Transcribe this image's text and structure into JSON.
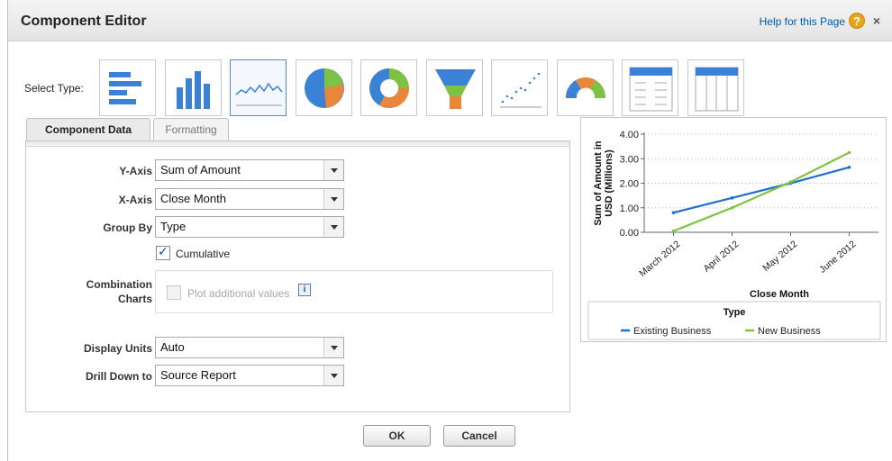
{
  "header": {
    "title": "Component Editor",
    "help_link": "Help for this Page",
    "help_icon": "?",
    "close_icon": "×"
  },
  "select_type": {
    "label": "Select Type:",
    "selected": "line",
    "options": [
      "horizontal-bar",
      "vertical-bar",
      "line",
      "pie",
      "donut",
      "funnel",
      "scatter",
      "gauge",
      "table",
      "table-grid"
    ]
  },
  "tabs": [
    {
      "label": "Component Data",
      "active": true
    },
    {
      "label": "Formatting",
      "active": false
    }
  ],
  "form": {
    "y_axis": {
      "label": "Y-Axis",
      "value": "Sum of Amount"
    },
    "x_axis": {
      "label": "X-Axis",
      "value": "Close Month"
    },
    "group_by": {
      "label": "Group By",
      "value": "Type"
    },
    "cumulative": {
      "label": "Cumulative",
      "checked": true
    },
    "combination_charts": {
      "label_line1": "Combination",
      "label_line2": "Charts"
    },
    "plot_additional": {
      "label": "Plot additional values",
      "checked": false,
      "disabled": true,
      "info_icon": "i"
    },
    "display_units": {
      "label": "Display Units",
      "value": "Auto"
    },
    "drill_down": {
      "label": "Drill Down to",
      "value": "Source Report"
    }
  },
  "chart_data": {
    "type": "line",
    "categories": [
      "March 2012",
      "April 2012",
      "May 2012",
      "June 2012"
    ],
    "ylabel_line1": "Sum of Amount in",
    "ylabel_line2": "USD (Millions)",
    "xlabel": "Close Month",
    "ylim": [
      0,
      4
    ],
    "yticks": [
      "0.00",
      "1.00",
      "2.00",
      "3.00",
      "4.00"
    ],
    "grid": true,
    "legend_title": "Type",
    "legend_position": "bottom",
    "series": [
      {
        "name": "Existing Business",
        "values": [
          0.8,
          1.4,
          2.0,
          2.65
        ],
        "color": "#1f6fd0"
      },
      {
        "name": "New Business",
        "values": [
          0.05,
          1.0,
          2.05,
          3.25
        ],
        "color": "#7dc242"
      }
    ]
  },
  "buttons": {
    "ok": "OK",
    "cancel": "Cancel"
  },
  "colors": {
    "accent_blue": "#3b82d6",
    "orange": "#e8873a",
    "green": "#7dc242",
    "help_orange": "#e8a317"
  }
}
